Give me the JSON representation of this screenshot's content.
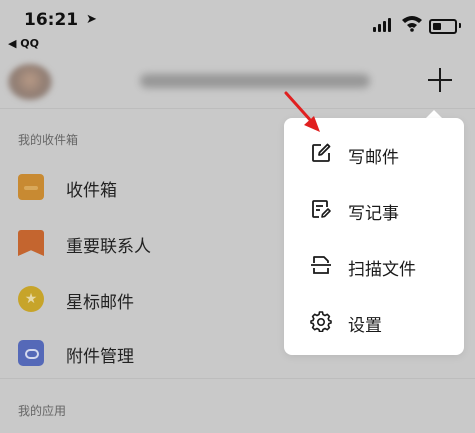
{
  "status_bar": {
    "time": "16:21",
    "back_label": "◀ QQ"
  },
  "account": {
    "add_label": "+"
  },
  "sections": {
    "mailbox": "我的收件箱",
    "apps": "我的应用"
  },
  "mailbox_items": [
    {
      "label": "收件箱",
      "icon": "inbox-icon",
      "color": "#c88a32"
    },
    {
      "label": "重要联系人",
      "icon": "bookmark-icon",
      "color": "#c4652f"
    },
    {
      "label": "星标邮件",
      "icon": "star-icon",
      "color": "#c7a42a"
    },
    {
      "label": "附件管理",
      "icon": "attachment-icon",
      "color": "#5569b8"
    }
  ],
  "menu": {
    "items": [
      {
        "label": "写邮件",
        "icon": "compose-icon"
      },
      {
        "label": "写记事",
        "icon": "note-icon"
      },
      {
        "label": "扫描文件",
        "icon": "scan-icon"
      },
      {
        "label": "设置",
        "icon": "gear-icon"
      }
    ]
  },
  "annotation": {
    "arrow_color": "#e02020"
  }
}
